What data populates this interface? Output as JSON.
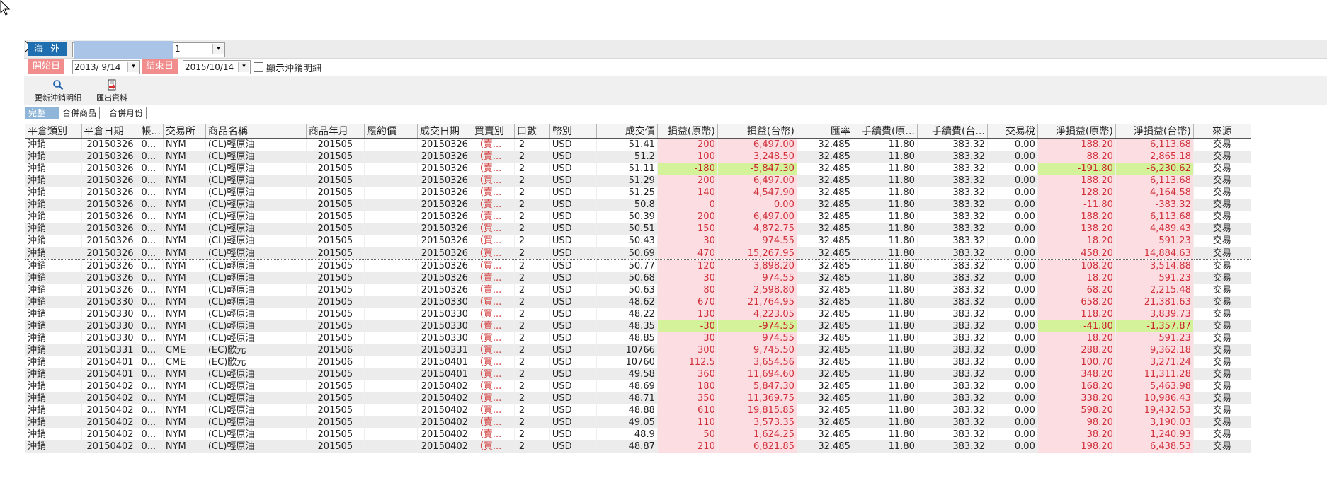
{
  "account_bar": {
    "market_label": "海 外",
    "account_tail": "1",
    "dropdown_symbol": "▾"
  },
  "date_bar": {
    "start_label": "開始日",
    "start_value": "2013/ 9/14",
    "end_label": "結束日",
    "end_value": "2015/10/14",
    "show_detail_label": "顯示沖銷明細"
  },
  "toolbar": {
    "refresh_label": "更新沖銷明細",
    "export_label": "匯出資料"
  },
  "tabs": [
    {
      "label": "完整",
      "active": true
    },
    {
      "label": "合併商品",
      "active": false
    },
    {
      "label": "合併月份",
      "active": false
    }
  ],
  "columns": [
    "平倉類別",
    "平倉日期",
    "帳...",
    "交易所",
    "商品名稱",
    "商品年月",
    "履約價",
    "成交日期",
    "買賣別",
    "口數",
    "幣別",
    "成交價",
    "損益(原幣)",
    "損益(台幣)",
    "匯率",
    "手續費(原...",
    "手續費(台...",
    "交易稅",
    "淨損益(原幣)",
    "淨損益(台幣)",
    "來源"
  ],
  "rows": [
    {
      "type": "沖銷",
      "close_date": "20150326",
      "acct": "0...",
      "exch": "NYM",
      "product": "(CL)輕原油",
      "ym": "201505",
      "strike": "",
      "trade_date": "20150326",
      "side": "（賣...",
      "qty": "2",
      "cur": "USD",
      "price": "51.41",
      "pl_orig": "200",
      "pl_twd": "6,497.00",
      "rate": "32.485",
      "fee_orig": "11.80",
      "fee_twd": "383.32",
      "tax": "0.00",
      "net_orig": "188.20",
      "net_twd": "6,113.68",
      "src": "交易",
      "loss": false
    },
    {
      "type": "沖銷",
      "close_date": "20150326",
      "acct": "0...",
      "exch": "NYM",
      "product": "(CL)輕原油",
      "ym": "201505",
      "strike": "",
      "trade_date": "20150326",
      "side": "（賣...",
      "qty": "2",
      "cur": "USD",
      "price": "51.2",
      "pl_orig": "100",
      "pl_twd": "3,248.50",
      "rate": "32.485",
      "fee_orig": "11.80",
      "fee_twd": "383.32",
      "tax": "0.00",
      "net_orig": "88.20",
      "net_twd": "2,865.18",
      "src": "交易",
      "loss": false
    },
    {
      "type": "沖銷",
      "close_date": "20150326",
      "acct": "0...",
      "exch": "NYM",
      "product": "(CL)輕原油",
      "ym": "201505",
      "strike": "",
      "trade_date": "20150326",
      "side": "（賣...",
      "qty": "2",
      "cur": "USD",
      "price": "51.11",
      "pl_orig": "-180",
      "pl_twd": "-5,847.30",
      "rate": "32.485",
      "fee_orig": "11.80",
      "fee_twd": "383.32",
      "tax": "0.00",
      "net_orig": "-191.80",
      "net_twd": "-6,230.62",
      "src": "交易",
      "loss": true
    },
    {
      "type": "沖銷",
      "close_date": "20150326",
      "acct": "0...",
      "exch": "NYM",
      "product": "(CL)輕原油",
      "ym": "201505",
      "strike": "",
      "trade_date": "20150326",
      "side": "（買...",
      "qty": "2",
      "cur": "USD",
      "price": "51.29",
      "pl_orig": "200",
      "pl_twd": "6,497.00",
      "rate": "32.485",
      "fee_orig": "11.80",
      "fee_twd": "383.32",
      "tax": "0.00",
      "net_orig": "188.20",
      "net_twd": "6,113.68",
      "src": "交易",
      "loss": false
    },
    {
      "type": "沖銷",
      "close_date": "20150326",
      "acct": "0...",
      "exch": "NYM",
      "product": "(CL)輕原油",
      "ym": "201505",
      "strike": "",
      "trade_date": "20150326",
      "side": "（賣...",
      "qty": "2",
      "cur": "USD",
      "price": "51.25",
      "pl_orig": "140",
      "pl_twd": "4,547.90",
      "rate": "32.485",
      "fee_orig": "11.80",
      "fee_twd": "383.32",
      "tax": "0.00",
      "net_orig": "128.20",
      "net_twd": "4,164.58",
      "src": "交易",
      "loss": false
    },
    {
      "type": "沖銷",
      "close_date": "20150326",
      "acct": "0...",
      "exch": "NYM",
      "product": "(CL)輕原油",
      "ym": "201505",
      "strike": "",
      "trade_date": "20150326",
      "side": "（賣...",
      "qty": "2",
      "cur": "USD",
      "price": "50.8",
      "pl_orig": "0",
      "pl_twd": "0.00",
      "rate": "32.485",
      "fee_orig": "11.80",
      "fee_twd": "383.32",
      "tax": "0.00",
      "net_orig": "-11.80",
      "net_twd": "-383.32",
      "src": "交易",
      "loss": false
    },
    {
      "type": "沖銷",
      "close_date": "20150326",
      "acct": "0...",
      "exch": "NYM",
      "product": "(CL)輕原油",
      "ym": "201505",
      "strike": "",
      "trade_date": "20150326",
      "side": "（賣...",
      "qty": "2",
      "cur": "USD",
      "price": "50.39",
      "pl_orig": "200",
      "pl_twd": "6,497.00",
      "rate": "32.485",
      "fee_orig": "11.80",
      "fee_twd": "383.32",
      "tax": "0.00",
      "net_orig": "188.20",
      "net_twd": "6,113.68",
      "src": "交易",
      "loss": false
    },
    {
      "type": "沖銷",
      "close_date": "20150326",
      "acct": "0...",
      "exch": "NYM",
      "product": "(CL)輕原油",
      "ym": "201505",
      "strike": "",
      "trade_date": "20150326",
      "side": "（買...",
      "qty": "2",
      "cur": "USD",
      "price": "50.51",
      "pl_orig": "150",
      "pl_twd": "4,872.75",
      "rate": "32.485",
      "fee_orig": "11.80",
      "fee_twd": "383.32",
      "tax": "0.00",
      "net_orig": "138.20",
      "net_twd": "4,489.43",
      "src": "交易",
      "loss": false
    },
    {
      "type": "沖銷",
      "close_date": "20150326",
      "acct": "0...",
      "exch": "NYM",
      "product": "(CL)輕原油",
      "ym": "201505",
      "strike": "",
      "trade_date": "20150326",
      "side": "（買...",
      "qty": "2",
      "cur": "USD",
      "price": "50.43",
      "pl_orig": "30",
      "pl_twd": "974.55",
      "rate": "32.485",
      "fee_orig": "11.80",
      "fee_twd": "383.32",
      "tax": "0.00",
      "net_orig": "18.20",
      "net_twd": "591.23",
      "src": "交易",
      "loss": false
    },
    {
      "type": "沖銷",
      "close_date": "20150326",
      "acct": "0...",
      "exch": "NYM",
      "product": "(CL)輕原油",
      "ym": "201505",
      "strike": "",
      "trade_date": "20150326",
      "side": "（買...",
      "qty": "2",
      "cur": "USD",
      "price": "50.69",
      "pl_orig": "470",
      "pl_twd": "15,267.95",
      "rate": "32.485",
      "fee_orig": "11.80",
      "fee_twd": "383.32",
      "tax": "0.00",
      "net_orig": "458.20",
      "net_twd": "14,884.63",
      "src": "交易",
      "loss": false,
      "focus": true
    },
    {
      "type": "沖銷",
      "close_date": "20150326",
      "acct": "0...",
      "exch": "NYM",
      "product": "(CL)輕原油",
      "ym": "201505",
      "strike": "",
      "trade_date": "20150326",
      "side": "（買...",
      "qty": "2",
      "cur": "USD",
      "price": "50.77",
      "pl_orig": "120",
      "pl_twd": "3,898.20",
      "rate": "32.485",
      "fee_orig": "11.80",
      "fee_twd": "383.32",
      "tax": "0.00",
      "net_orig": "108.20",
      "net_twd": "3,514.88",
      "src": "交易",
      "loss": false
    },
    {
      "type": "沖銷",
      "close_date": "20150326",
      "acct": "0...",
      "exch": "NYM",
      "product": "(CL)輕原油",
      "ym": "201505",
      "strike": "",
      "trade_date": "20150326",
      "side": "（賣...",
      "qty": "2",
      "cur": "USD",
      "price": "50.68",
      "pl_orig": "30",
      "pl_twd": "974.55",
      "rate": "32.485",
      "fee_orig": "11.80",
      "fee_twd": "383.32",
      "tax": "0.00",
      "net_orig": "18.20",
      "net_twd": "591.23",
      "src": "交易",
      "loss": false
    },
    {
      "type": "沖銷",
      "close_date": "20150326",
      "acct": "0...",
      "exch": "NYM",
      "product": "(CL)輕原油",
      "ym": "201505",
      "strike": "",
      "trade_date": "20150326",
      "side": "（賣...",
      "qty": "2",
      "cur": "USD",
      "price": "50.63",
      "pl_orig": "80",
      "pl_twd": "2,598.80",
      "rate": "32.485",
      "fee_orig": "11.80",
      "fee_twd": "383.32",
      "tax": "0.00",
      "net_orig": "68.20",
      "net_twd": "2,215.48",
      "src": "交易",
      "loss": false
    },
    {
      "type": "沖銷",
      "close_date": "20150330",
      "acct": "0...",
      "exch": "NYM",
      "product": "(CL)輕原油",
      "ym": "201505",
      "strike": "",
      "trade_date": "20150330",
      "side": "（買...",
      "qty": "2",
      "cur": "USD",
      "price": "48.62",
      "pl_orig": "670",
      "pl_twd": "21,764.95",
      "rate": "32.485",
      "fee_orig": "11.80",
      "fee_twd": "383.32",
      "tax": "0.00",
      "net_orig": "658.20",
      "net_twd": "21,381.63",
      "src": "交易",
      "loss": false
    },
    {
      "type": "沖銷",
      "close_date": "20150330",
      "acct": "0...",
      "exch": "NYM",
      "product": "(CL)輕原油",
      "ym": "201505",
      "strike": "",
      "trade_date": "20150330",
      "side": "（買...",
      "qty": "2",
      "cur": "USD",
      "price": "48.22",
      "pl_orig": "130",
      "pl_twd": "4,223.05",
      "rate": "32.485",
      "fee_orig": "11.80",
      "fee_twd": "383.32",
      "tax": "0.00",
      "net_orig": "118.20",
      "net_twd": "3,839.73",
      "src": "交易",
      "loss": false
    },
    {
      "type": "沖銷",
      "close_date": "20150330",
      "acct": "0...",
      "exch": "NYM",
      "product": "(CL)輕原油",
      "ym": "201505",
      "strike": "",
      "trade_date": "20150330",
      "side": "（賣...",
      "qty": "2",
      "cur": "USD",
      "price": "48.35",
      "pl_orig": "-30",
      "pl_twd": "-974.55",
      "rate": "32.485",
      "fee_orig": "11.80",
      "fee_twd": "383.32",
      "tax": "0.00",
      "net_orig": "-41.80",
      "net_twd": "-1,357.87",
      "src": "交易",
      "loss": true
    },
    {
      "type": "沖銷",
      "close_date": "20150330",
      "acct": "0...",
      "exch": "NYM",
      "product": "(CL)輕原油",
      "ym": "201505",
      "strike": "",
      "trade_date": "20150330",
      "side": "（買...",
      "qty": "2",
      "cur": "USD",
      "price": "48.85",
      "pl_orig": "30",
      "pl_twd": "974.55",
      "rate": "32.485",
      "fee_orig": "11.80",
      "fee_twd": "383.32",
      "tax": "0.00",
      "net_orig": "18.20",
      "net_twd": "591.23",
      "src": "交易",
      "loss": false
    },
    {
      "type": "沖銷",
      "close_date": "20150331",
      "acct": "0...",
      "exch": "CME",
      "product": "(EC)歐元",
      "ym": "201506",
      "strike": "",
      "trade_date": "20150331",
      "side": "（買...",
      "qty": "2",
      "cur": "USD",
      "price": "10766",
      "pl_orig": "300",
      "pl_twd": "9,745.50",
      "rate": "32.485",
      "fee_orig": "11.80",
      "fee_twd": "383.32",
      "tax": "0.00",
      "net_orig": "288.20",
      "net_twd": "9,362.18",
      "src": "交易",
      "loss": false
    },
    {
      "type": "沖銷",
      "close_date": "20150401",
      "acct": "0...",
      "exch": "CME",
      "product": "(EC)歐元",
      "ym": "201506",
      "strike": "",
      "trade_date": "20150401",
      "side": "（買...",
      "qty": "2",
      "cur": "USD",
      "price": "10760",
      "pl_orig": "112.5",
      "pl_twd": "3,654.56",
      "rate": "32.485",
      "fee_orig": "11.80",
      "fee_twd": "383.32",
      "tax": "0.00",
      "net_orig": "100.70",
      "net_twd": "3,271.24",
      "src": "交易",
      "loss": false
    },
    {
      "type": "沖銷",
      "close_date": "20150401",
      "acct": "0...",
      "exch": "NYM",
      "product": "(CL)輕原油",
      "ym": "201505",
      "strike": "",
      "trade_date": "20150401",
      "side": "（買...",
      "qty": "2",
      "cur": "USD",
      "price": "49.58",
      "pl_orig": "360",
      "pl_twd": "11,694.60",
      "rate": "32.485",
      "fee_orig": "11.80",
      "fee_twd": "383.32",
      "tax": "0.00",
      "net_orig": "348.20",
      "net_twd": "11,311.28",
      "src": "交易",
      "loss": false
    },
    {
      "type": "沖銷",
      "close_date": "20150402",
      "acct": "0...",
      "exch": "NYM",
      "product": "(CL)輕原油",
      "ym": "201505",
      "strike": "",
      "trade_date": "20150402",
      "side": "（買...",
      "qty": "2",
      "cur": "USD",
      "price": "48.69",
      "pl_orig": "180",
      "pl_twd": "5,847.30",
      "rate": "32.485",
      "fee_orig": "11.80",
      "fee_twd": "383.32",
      "tax": "0.00",
      "net_orig": "168.20",
      "net_twd": "5,463.98",
      "src": "交易",
      "loss": false
    },
    {
      "type": "沖銷",
      "close_date": "20150402",
      "acct": "0...",
      "exch": "NYM",
      "product": "(CL)輕原油",
      "ym": "201505",
      "strike": "",
      "trade_date": "20150402",
      "side": "（買...",
      "qty": "2",
      "cur": "USD",
      "price": "48.71",
      "pl_orig": "350",
      "pl_twd": "11,369.75",
      "rate": "32.485",
      "fee_orig": "11.80",
      "fee_twd": "383.32",
      "tax": "0.00",
      "net_orig": "338.20",
      "net_twd": "10,986.43",
      "src": "交易",
      "loss": false
    },
    {
      "type": "沖銷",
      "close_date": "20150402",
      "acct": "0...",
      "exch": "NYM",
      "product": "(CL)輕原油",
      "ym": "201505",
      "strike": "",
      "trade_date": "20150402",
      "side": "（買...",
      "qty": "2",
      "cur": "USD",
      "price": "48.88",
      "pl_orig": "610",
      "pl_twd": "19,815.85",
      "rate": "32.485",
      "fee_orig": "11.80",
      "fee_twd": "383.32",
      "tax": "0.00",
      "net_orig": "598.20",
      "net_twd": "19,432.53",
      "src": "交易",
      "loss": false
    },
    {
      "type": "沖銷",
      "close_date": "20150402",
      "acct": "0...",
      "exch": "NYM",
      "product": "(CL)輕原油",
      "ym": "201505",
      "strike": "",
      "trade_date": "20150402",
      "side": "（賣...",
      "qty": "2",
      "cur": "USD",
      "price": "49.05",
      "pl_orig": "110",
      "pl_twd": "3,573.35",
      "rate": "32.485",
      "fee_orig": "11.80",
      "fee_twd": "383.32",
      "tax": "0.00",
      "net_orig": "98.20",
      "net_twd": "3,190.03",
      "src": "交易",
      "loss": false
    },
    {
      "type": "沖銷",
      "close_date": "20150402",
      "acct": "0...",
      "exch": "NYM",
      "product": "(CL)輕原油",
      "ym": "201505",
      "strike": "",
      "trade_date": "20150402",
      "side": "（賣...",
      "qty": "2",
      "cur": "USD",
      "price": "48.9",
      "pl_orig": "50",
      "pl_twd": "1,624.25",
      "rate": "32.485",
      "fee_orig": "11.80",
      "fee_twd": "383.32",
      "tax": "0.00",
      "net_orig": "38.20",
      "net_twd": "1,240.93",
      "src": "交易",
      "loss": false
    },
    {
      "type": "沖銷",
      "close_date": "20150402",
      "acct": "0...",
      "exch": "NYM",
      "product": "(CL)輕原油",
      "ym": "201505",
      "strike": "",
      "trade_date": "20150402",
      "side": "（買...",
      "qty": "2",
      "cur": "USD",
      "price": "48.87",
      "pl_orig": "210",
      "pl_twd": "6,821.85",
      "rate": "32.485",
      "fee_orig": "11.80",
      "fee_twd": "383.32",
      "tax": "0.00",
      "net_orig": "198.20",
      "net_twd": "6,438.53",
      "src": "交易",
      "loss": false
    }
  ],
  "colors": {
    "profit_bg": "#fbdde2",
    "loss_bg": "#d4f29a",
    "value_text": "#d0303a",
    "market_tag": "#1f6fb0",
    "date_tag": "#f18d8d",
    "active_tab": "#8fb6d9"
  },
  "icons": {
    "cursor": "mouse-pointer-icon",
    "refresh": "magnifier-icon",
    "export": "export-document-icon"
  }
}
